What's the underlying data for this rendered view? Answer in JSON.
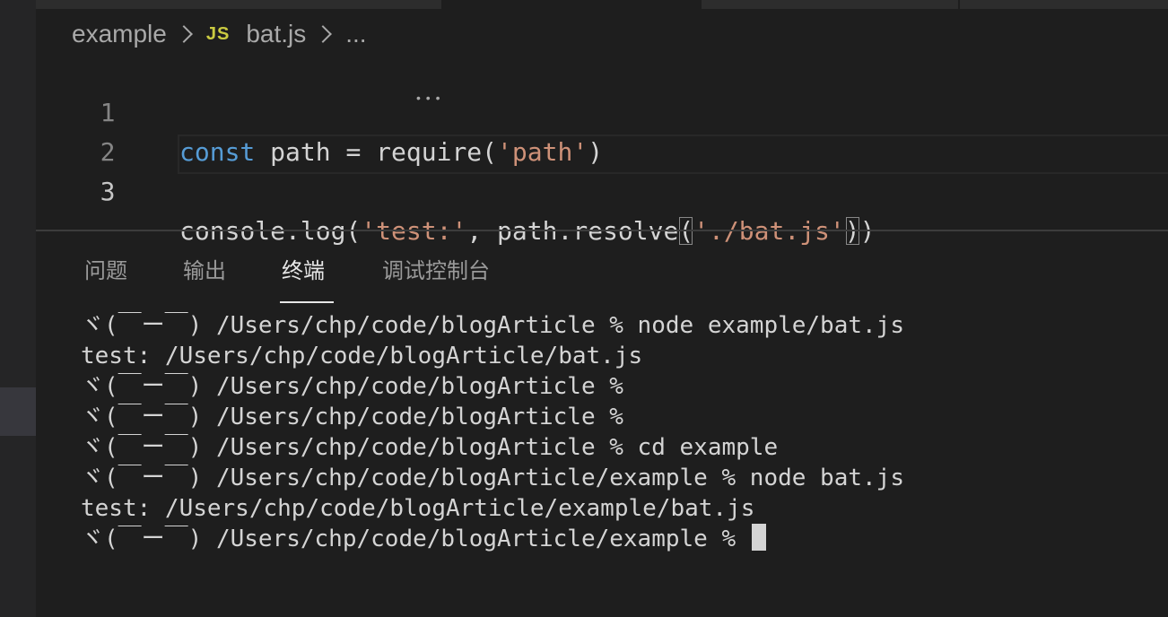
{
  "breadcrumb": {
    "folder": "example",
    "file_badge": "JS",
    "file": "bat.js",
    "more": "..."
  },
  "editor": {
    "lines": [
      {
        "number": "1",
        "tokens": [
          {
            "t": "const",
            "c": "kw"
          },
          {
            "t": " path = ",
            "c": "plain"
          },
          {
            "t": "require",
            "c": "plain"
          },
          {
            "t": "(",
            "c": "plain"
          },
          {
            "t": "'path'",
            "c": "str"
          },
          {
            "t": ")",
            "c": "plain"
          }
        ]
      },
      {
        "number": "2",
        "tokens": []
      },
      {
        "number": "3",
        "tokens": [
          {
            "t": "console.log(",
            "c": "plain"
          },
          {
            "t": "'test:'",
            "c": "str"
          },
          {
            "t": ", path.resolve",
            "c": "plain"
          },
          {
            "t": "(",
            "c": "plain brk"
          },
          {
            "t": "'./bat.js'",
            "c": "str"
          },
          {
            "t": ")",
            "c": "plain brk"
          },
          {
            "t": ")",
            "c": "plain"
          }
        ]
      }
    ]
  },
  "panel": {
    "tabs": [
      {
        "label": "问题"
      },
      {
        "label": "输出"
      },
      {
        "label": "终端"
      },
      {
        "label": "调试控制台"
      }
    ],
    "active_tab": "终端"
  },
  "terminal": {
    "lines": [
      "ヾ(￣ー￣) /Users/chp/code/blogArticle % node example/bat.js",
      "test: /Users/chp/code/blogArticle/bat.js",
      "ヾ(￣ー￣) /Users/chp/code/blogArticle %",
      "ヾ(￣ー￣) /Users/chp/code/blogArticle %",
      "ヾ(￣ー￣) /Users/chp/code/blogArticle % cd example",
      "ヾ(￣ー￣) /Users/chp/code/blogArticle/example % node bat.js",
      "test: /Users/chp/code/blogArticle/example/bat.js",
      "ヾ(￣ー￣) /Users/chp/code/blogArticle/example % "
    ]
  }
}
